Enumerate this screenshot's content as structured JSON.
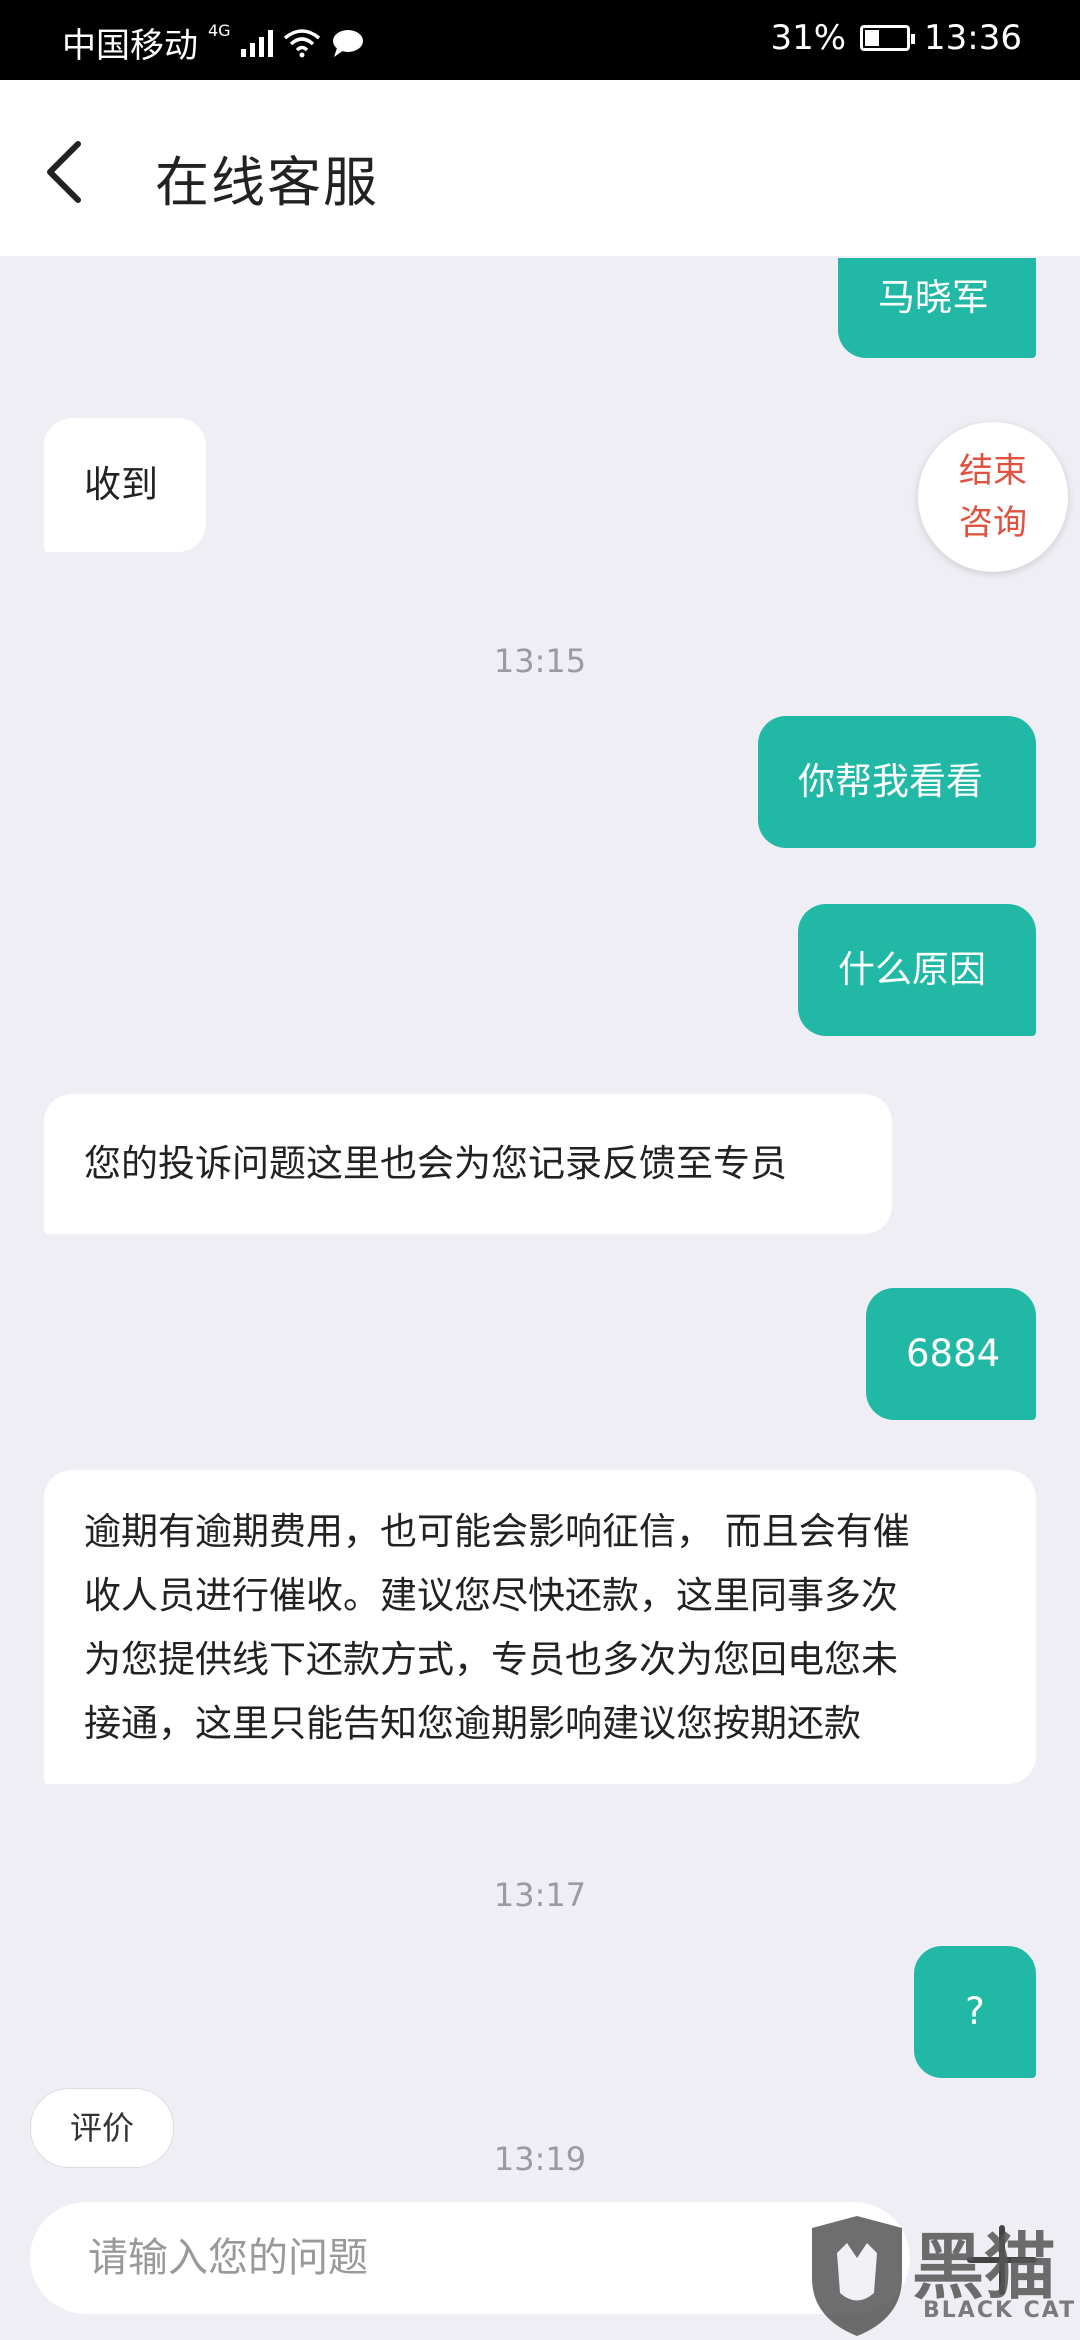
{
  "status": {
    "carrier": "中国移动",
    "network": "4G",
    "battery": "31%",
    "time": "13:36"
  },
  "header": {
    "title": "在线客服"
  },
  "end_button": {
    "line1": "结束",
    "line2": "咨询"
  },
  "messages": [
    {
      "side": "out",
      "text": "马晓军"
    },
    {
      "side": "in",
      "text": "收到"
    },
    {
      "type": "time",
      "text": "13:15"
    },
    {
      "side": "out",
      "text": "你帮我看看"
    },
    {
      "side": "out",
      "text": "什么原因"
    },
    {
      "side": "in",
      "text": "您的投诉问题这里也会为您记录反馈至专员"
    },
    {
      "side": "out",
      "text": "6884"
    },
    {
      "side": "in",
      "lines": [
        "逾期有逾期费用，也可能会影响征信， 而且会有催",
        "收人员进行催收。建议您尽快还款，这里同事多次",
        "为您提供线下还款方式，专员也多次为您回电您未",
        "接通，这里只能告知您逾期影响建议您按期还款"
      ]
    },
    {
      "type": "time",
      "text": "13:17"
    },
    {
      "side": "out",
      "text": "?"
    },
    {
      "type": "time",
      "text": "13:19"
    }
  ],
  "rate_button": "评价",
  "input": {
    "placeholder": "请输入您的问题"
  },
  "watermark": {
    "big": "黑猫",
    "small": "BLACK CAT"
  }
}
